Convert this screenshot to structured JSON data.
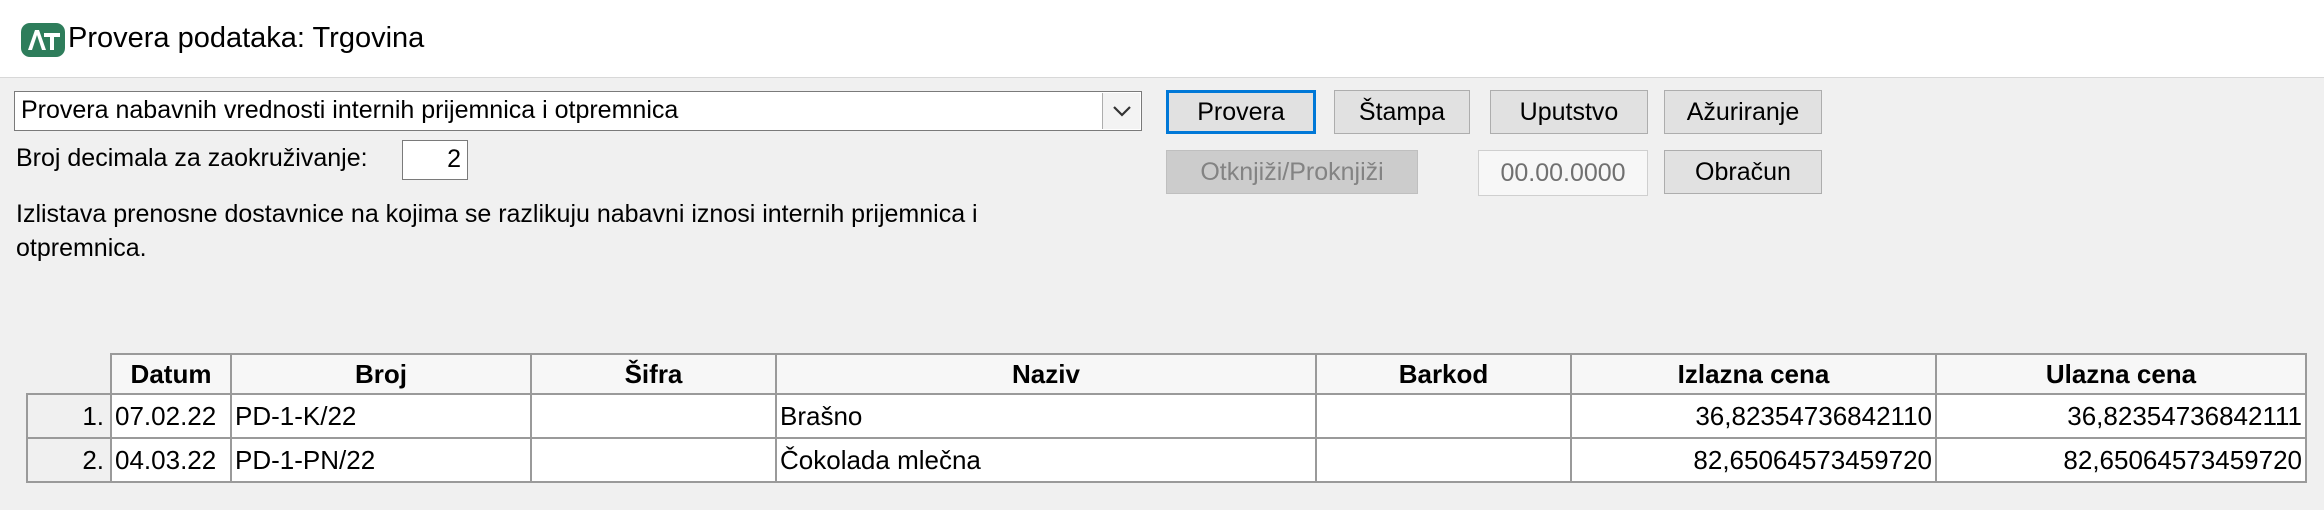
{
  "window": {
    "title": "Provera podataka: Trgovina"
  },
  "check_type": {
    "selected": "Provera nabavnih vrednosti internih prijemnica i otpremnica"
  },
  "decimals": {
    "label": "Broj decimala za zaokruživanje:",
    "value": "2"
  },
  "description": "Izlistava prenosne dostavnice na kojima se razlikuju nabavni iznosi internih prijemnica i otpremnica.",
  "buttons": {
    "provera": "Provera",
    "stampa": "Štampa",
    "uputstvo": "Uputstvo",
    "azuriranje": "Ažuriranje",
    "otknjizi": "Otknjiži/Proknjiži",
    "obracun": "Obračun"
  },
  "date_field": "00.00.0000",
  "table": {
    "columns": [
      "Datum",
      "Broj",
      "Šifra",
      "Naziv",
      "Barkod",
      "Izlazna cena",
      "Ulazna cena"
    ],
    "rows": [
      {
        "num": "1.",
        "datum": "07.02.22",
        "broj": "PD-1-K/22",
        "sifra": "",
        "naziv": "Brašno",
        "barkod": "",
        "izlazna": "36,82354736842110",
        "ulazna": "36,82354736842111"
      },
      {
        "num": "2.",
        "datum": "04.03.22",
        "broj": "PD-1-PN/22",
        "sifra": "",
        "naziv": "Čokolada mlečna",
        "barkod": "",
        "izlazna": "82,65064573459720",
        "ulazna": "82,65064573459720"
      }
    ]
  }
}
